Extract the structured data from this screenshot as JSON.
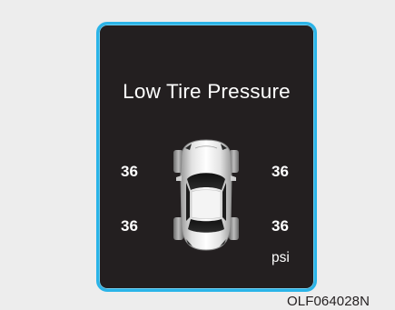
{
  "warning": {
    "title": "Low Tire Pressure",
    "unit": "psi",
    "tires": {
      "front_left": "36",
      "front_right": "36",
      "rear_left": "36",
      "rear_right": "36"
    }
  },
  "caption": "OLF064028N",
  "colors": {
    "frame_border": "#2ab4e8",
    "screen_background": "#231f20",
    "text": "#ffffff"
  },
  "icons": {
    "car": "car-top-view-icon"
  }
}
